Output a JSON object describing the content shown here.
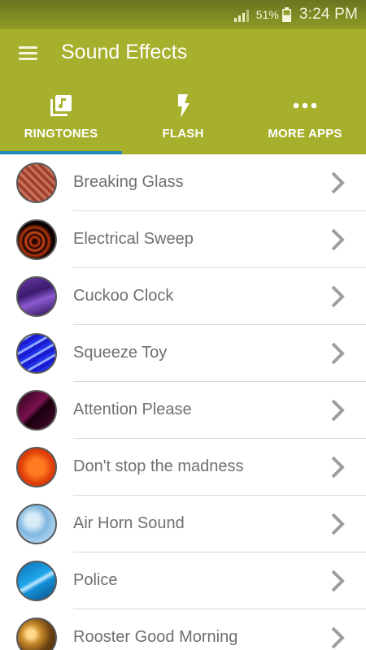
{
  "status_bar": {
    "battery_percent": "51%",
    "time": "3:24 PM",
    "icons": [
      "signal-icon",
      "battery-icon"
    ]
  },
  "app_bar": {
    "title": "Sound Effects",
    "menu_icon": "hamburger-menu-icon"
  },
  "tabs": [
    {
      "label": "RINGTONES",
      "icon": "music-library-icon",
      "selected": true
    },
    {
      "label": "FLASH",
      "icon": "flash-icon",
      "selected": false
    },
    {
      "label": "MORE APPS",
      "icon": "more-dots-icon",
      "selected": false
    }
  ],
  "sounds": [
    {
      "name": "Breaking Glass"
    },
    {
      "name": "Electrical Sweep"
    },
    {
      "name": "Cuckoo Clock"
    },
    {
      "name": "Squeeze Toy"
    },
    {
      "name": "Attention Please"
    },
    {
      "name": "Don't stop the madness"
    },
    {
      "name": "Air Horn Sound"
    },
    {
      "name": "Police"
    },
    {
      "name": "Rooster Good Morning"
    }
  ],
  "colors": {
    "app_bar": "#a6b02c",
    "status_bar": "#8f9b27",
    "tab_indicator": "#1e88b9",
    "list_text": "#6f6f6f",
    "chevron": "#9e9e9e"
  }
}
